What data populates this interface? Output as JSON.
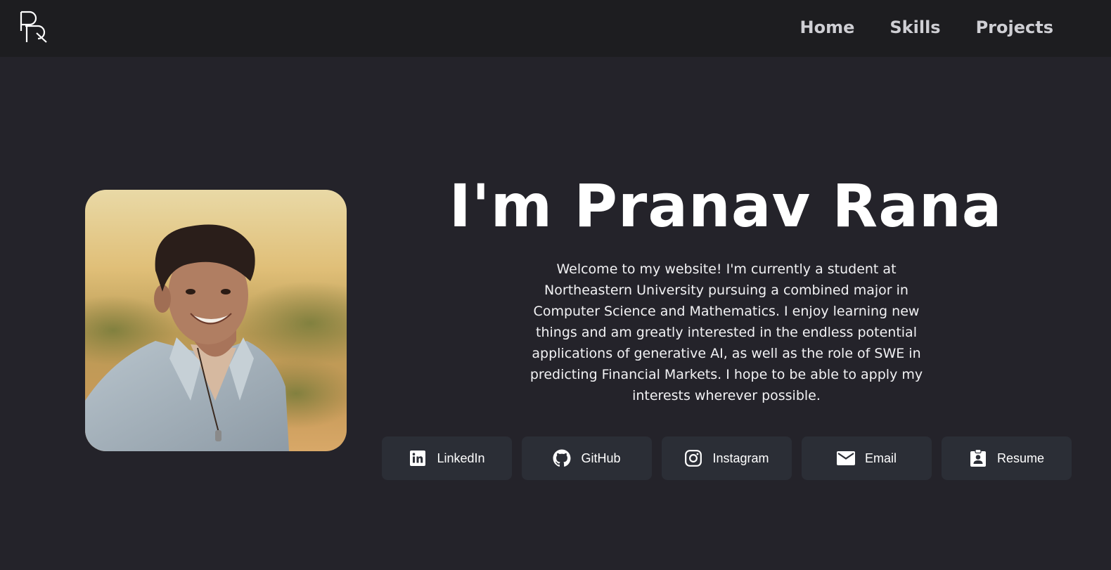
{
  "nav": {
    "logo_text": "PR",
    "links": [
      {
        "label": "Home"
      },
      {
        "label": "Skills"
      },
      {
        "label": "Projects"
      }
    ]
  },
  "hero": {
    "title": "I'm Pranav Rana",
    "description": "Welcome to my website! I'm currently a student at Northeastern University pursuing a combined major in Computer Science and Mathematics. I enjoy learning new things and am greatly interested in the endless potential applications of generative AI, as well as the role of SWE in predicting Financial Markets. I hope to be able to apply my interests wherever possible."
  },
  "socials": [
    {
      "label": "LinkedIn",
      "icon": "linkedin-icon"
    },
    {
      "label": "GitHub",
      "icon": "github-icon"
    },
    {
      "label": "Instagram",
      "icon": "instagram-icon"
    },
    {
      "label": "Email",
      "icon": "email-icon"
    },
    {
      "label": "Resume",
      "icon": "resume-icon"
    }
  ],
  "colors": {
    "background": "#24232a",
    "navbar": "#1d1d20",
    "button": "#2b2e36",
    "text": "#ffffff",
    "nav_text": "#cfcfd4"
  }
}
